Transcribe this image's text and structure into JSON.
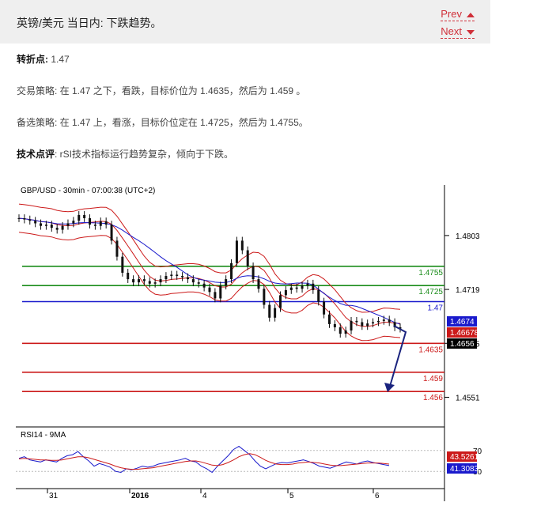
{
  "header": {
    "title": "英镑/美元 当日内: 下跌趋势。",
    "prev_label": "Prev",
    "next_label": "Next"
  },
  "pivot": {
    "label": "转折点:",
    "value": " 1.47"
  },
  "strategy": {
    "label": "交易策略:",
    "text": " 在 1.47 之下，看跌，目标价位为 1.4635，然后为 1.459 。"
  },
  "alternative": {
    "label": "备选策略:",
    "text": " 在 1.47 上，看涨，目标价位定在 1.4725，然后为 1.4755。"
  },
  "technical": {
    "label": "技术点评",
    "text": ": rSI技术指标运行趋势复杂，倾向于下跌。"
  },
  "chart_data": {
    "type": "line",
    "title": "GBP/USD - 30min - 07:00:38 (UTC+2)",
    "x_tick_labels": [
      "31",
      "2016",
      "4",
      "5",
      "6"
    ],
    "y_tick_labels": [
      "1.4803",
      "1.4719",
      "1.4635",
      "1.4551"
    ],
    "ylim": [
      1.4522,
      1.4862
    ],
    "price": [
      1.483,
      1.4828,
      1.4826,
      1.4822,
      1.4818,
      1.482,
      1.4815,
      1.4812,
      1.4818,
      1.4822,
      1.4826,
      1.4835,
      1.483,
      1.482,
      1.4818,
      1.4825,
      1.482,
      1.4795,
      1.477,
      1.4745,
      1.4735,
      1.473,
      1.4735,
      1.4732,
      1.4728,
      1.473,
      1.4735,
      1.474,
      1.4742,
      1.474,
      1.4738,
      1.4735,
      1.473,
      1.4728,
      1.4722,
      1.4715,
      1.4705,
      1.4725,
      1.4735,
      1.476,
      1.4795,
      1.478,
      1.4755,
      1.4735,
      1.472,
      1.4695,
      1.4675,
      1.469,
      1.471,
      1.4718,
      1.4722,
      1.472,
      1.4725,
      1.4728,
      1.4718,
      1.47,
      1.468,
      1.4665,
      1.466,
      1.465,
      1.4655,
      1.467,
      1.4668,
      1.4662,
      1.4666,
      1.4668,
      1.467,
      1.4672,
      1.4668,
      1.466,
      1.4658
    ],
    "rsi": [
      55,
      58,
      52,
      50,
      48,
      52,
      50,
      48,
      55,
      60,
      62,
      68,
      58,
      50,
      40,
      45,
      42,
      38,
      30,
      28,
      35,
      33,
      36,
      40,
      38,
      40,
      44,
      46,
      48,
      50,
      52,
      55,
      50,
      48,
      40,
      35,
      28,
      40,
      50,
      60,
      72,
      78,
      70,
      62,
      50,
      40,
      35,
      40,
      45,
      47,
      46,
      48,
      50,
      52,
      49,
      45,
      40,
      38,
      36,
      40,
      44,
      48,
      46,
      44,
      48,
      50,
      47,
      45,
      43,
      41
    ],
    "rsi_ma": [
      54,
      55,
      54,
      53,
      52,
      52,
      51,
      51,
      52,
      54,
      56,
      58,
      58,
      56,
      53,
      50,
      47,
      44,
      40,
      37,
      35,
      34,
      34,
      35,
      36,
      37,
      39,
      41,
      43,
      45,
      47,
      49,
      50,
      50,
      48,
      45,
      42,
      41,
      43,
      47,
      52,
      58,
      62,
      64,
      62,
      57,
      51,
      47,
      44,
      43,
      43,
      44,
      46,
      47,
      48,
      47,
      46,
      44,
      42,
      41,
      41,
      42,
      43,
      44,
      45,
      46,
      46,
      46,
      45,
      44
    ],
    "levels": [
      {
        "value": "1.4755",
        "color": "#1a8c1a"
      },
      {
        "value": "1.4725",
        "color": "#1a8c1a"
      },
      {
        "value": "1.47",
        "color": "#1a1acc"
      },
      {
        "value": "1.4635",
        "color": "#cc1a1a"
      },
      {
        "value": "1.459",
        "color": "#cc1a1a"
      },
      {
        "value": "1.456",
        "color": "#cc1a1a"
      }
    ],
    "tags": [
      {
        "value": "1.4674",
        "bg": "#1a1acc"
      },
      {
        "value": "1.46678",
        "bg": "#cc1a1a"
      },
      {
        "value": "1.4656",
        "bg": "#000000"
      }
    ],
    "rsi_panel": {
      "title": "RSI14 - 9MA",
      "y_tick_labels": [
        "70",
        "30"
      ],
      "tags": [
        {
          "value": "43.5261",
          "bg": "#cc1a1a"
        },
        {
          "value": "41.3083",
          "bg": "#1a1acc"
        }
      ]
    }
  }
}
